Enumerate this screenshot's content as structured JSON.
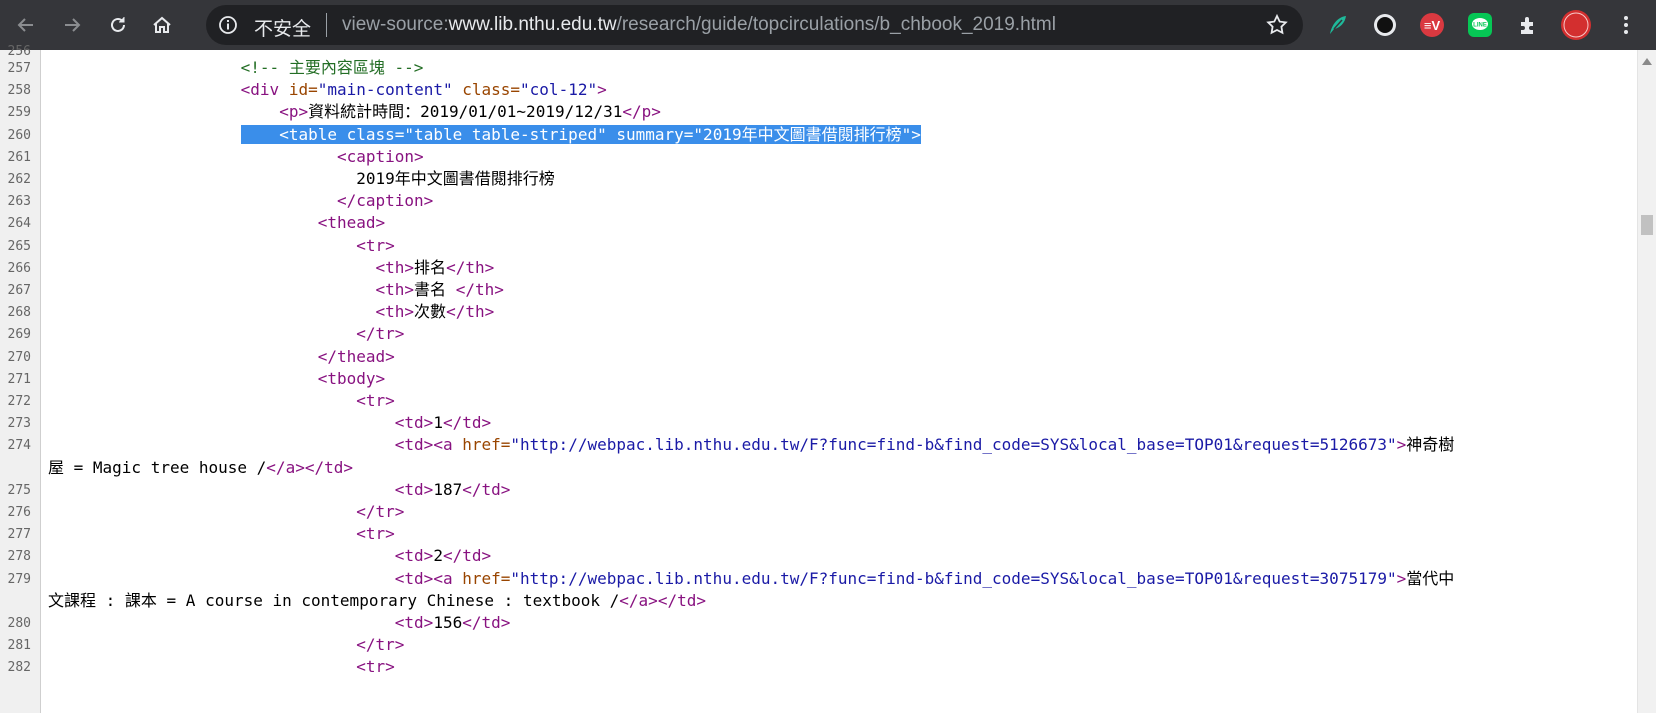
{
  "browser": {
    "security_label": "不安全",
    "url_prefix": "view-source:",
    "url_host": "www.lib.nthu.edu.tw",
    "url_path": "/research/guide/topcirculations/b_chbook_2019.html",
    "extensions": [
      "feather-extension-icon",
      "circle-extension-icon",
      "expressvpn-extension-icon",
      "line-extension-icon",
      "puzzle-extensions-icon",
      "profile-seal-avatar"
    ],
    "profile_seal_text": "貨品小屋"
  },
  "source": {
    "partial_top_line": "256",
    "lines": [
      {
        "num": "257",
        "segs": [
          {
            "t": "cmt",
            "v": "                    <!-- 主要內容區塊 -->"
          }
        ]
      },
      {
        "num": "258",
        "segs": [
          {
            "t": "txt",
            "v": "                    "
          },
          {
            "t": "tag",
            "v": "<div "
          },
          {
            "t": "attr",
            "v": "id="
          },
          {
            "t": "val",
            "v": "\"main-content\""
          },
          {
            "t": "attr",
            "v": " class="
          },
          {
            "t": "val",
            "v": "\"col-12\""
          },
          {
            "t": "tag",
            "v": ">"
          }
        ]
      },
      {
        "num": "259",
        "segs": [
          {
            "t": "txt",
            "v": "                        "
          },
          {
            "t": "tag",
            "v": "<p>"
          },
          {
            "t": "txt",
            "v": "資料統計時間：2019/01/01~2019/12/31"
          },
          {
            "t": "tag",
            "v": "</p>"
          }
        ]
      },
      {
        "num": "260",
        "selected": true,
        "indent": "                    ",
        "segs": [
          {
            "t": "tag",
            "v": "    <table "
          },
          {
            "t": "attr",
            "v": "class="
          },
          {
            "t": "val",
            "v": "\"table table-striped\""
          },
          {
            "t": "attr",
            "v": " summary="
          },
          {
            "t": "val",
            "v": "\"2019年中文圖書借閱排行榜\""
          },
          {
            "t": "tag",
            "v": ">"
          }
        ]
      },
      {
        "num": "261",
        "segs": [
          {
            "t": "txt",
            "v": "                              "
          },
          {
            "t": "tag",
            "v": "<caption>"
          }
        ]
      },
      {
        "num": "262",
        "segs": [
          {
            "t": "txt",
            "v": "                                2019年中文圖書借閱排行榜"
          }
        ]
      },
      {
        "num": "263",
        "segs": [
          {
            "t": "txt",
            "v": "                              "
          },
          {
            "t": "tag",
            "v": "</caption>"
          }
        ]
      },
      {
        "num": "264",
        "segs": [
          {
            "t": "txt",
            "v": "                            "
          },
          {
            "t": "tag",
            "v": "<thead>"
          }
        ]
      },
      {
        "num": "265",
        "segs": [
          {
            "t": "txt",
            "v": "                                "
          },
          {
            "t": "tag",
            "v": "<tr>"
          }
        ]
      },
      {
        "num": "266",
        "segs": [
          {
            "t": "txt",
            "v": "                                  "
          },
          {
            "t": "tag",
            "v": "<th>"
          },
          {
            "t": "txt",
            "v": "排名"
          },
          {
            "t": "tag",
            "v": "</th>"
          }
        ]
      },
      {
        "num": "267",
        "segs": [
          {
            "t": "txt",
            "v": "                                  "
          },
          {
            "t": "tag",
            "v": "<th>"
          },
          {
            "t": "txt",
            "v": "書名 "
          },
          {
            "t": "tag",
            "v": "</th>"
          }
        ]
      },
      {
        "num": "268",
        "segs": [
          {
            "t": "txt",
            "v": "                                  "
          },
          {
            "t": "tag",
            "v": "<th>"
          },
          {
            "t": "txt",
            "v": "次數"
          },
          {
            "t": "tag",
            "v": "</th>"
          }
        ]
      },
      {
        "num": "269",
        "segs": [
          {
            "t": "txt",
            "v": "                                "
          },
          {
            "t": "tag",
            "v": "</tr>"
          }
        ]
      },
      {
        "num": "270",
        "segs": [
          {
            "t": "txt",
            "v": "                            "
          },
          {
            "t": "tag",
            "v": "</thead>"
          }
        ]
      },
      {
        "num": "271",
        "segs": [
          {
            "t": "txt",
            "v": "                            "
          },
          {
            "t": "tag",
            "v": "<tbody>"
          }
        ]
      },
      {
        "num": "272",
        "segs": [
          {
            "t": "txt",
            "v": "                                "
          },
          {
            "t": "tag",
            "v": "<tr>"
          }
        ]
      },
      {
        "num": "273",
        "segs": [
          {
            "t": "txt",
            "v": "                                    "
          },
          {
            "t": "tag",
            "v": "<td>"
          },
          {
            "t": "txt",
            "v": "1"
          },
          {
            "t": "tag",
            "v": "</td>"
          }
        ]
      },
      {
        "num": "274",
        "segs": [
          {
            "t": "txt",
            "v": "                                    "
          },
          {
            "t": "tag",
            "v": "<td><a "
          },
          {
            "t": "attr",
            "v": "href="
          },
          {
            "t": "val",
            "v": "\"http://webpac.lib.nthu.edu.tw/F?func=find-b&find_code=SYS&local_base=TOP01&request=5126673\""
          },
          {
            "t": "tag",
            "v": ">"
          },
          {
            "t": "txt",
            "v": "神奇樹"
          }
        ]
      },
      {
        "num": "",
        "segs": [
          {
            "t": "txt",
            "v": "屋 = Magic tree house /"
          },
          {
            "t": "tag",
            "v": "</a></td>"
          }
        ]
      },
      {
        "num": "275",
        "segs": [
          {
            "t": "txt",
            "v": "                                    "
          },
          {
            "t": "tag",
            "v": "<td>"
          },
          {
            "t": "txt",
            "v": "187"
          },
          {
            "t": "tag",
            "v": "</td>"
          }
        ]
      },
      {
        "num": "276",
        "segs": [
          {
            "t": "txt",
            "v": "                                "
          },
          {
            "t": "tag",
            "v": "</tr>"
          }
        ]
      },
      {
        "num": "277",
        "segs": [
          {
            "t": "txt",
            "v": "                                "
          },
          {
            "t": "tag",
            "v": "<tr>"
          }
        ]
      },
      {
        "num": "278",
        "segs": [
          {
            "t": "txt",
            "v": "                                    "
          },
          {
            "t": "tag",
            "v": "<td>"
          },
          {
            "t": "txt",
            "v": "2"
          },
          {
            "t": "tag",
            "v": "</td>"
          }
        ]
      },
      {
        "num": "279",
        "segs": [
          {
            "t": "txt",
            "v": "                                    "
          },
          {
            "t": "tag",
            "v": "<td><a "
          },
          {
            "t": "attr",
            "v": "href="
          },
          {
            "t": "val",
            "v": "\"http://webpac.lib.nthu.edu.tw/F?func=find-b&find_code=SYS&local_base=TOP01&request=3075179\""
          },
          {
            "t": "tag",
            "v": ">"
          },
          {
            "t": "txt",
            "v": "當代中"
          }
        ]
      },
      {
        "num": "",
        "segs": [
          {
            "t": "txt",
            "v": "文課程 : 課本 = A course in contemporary Chinese : textbook /"
          },
          {
            "t": "tag",
            "v": "</a></td>"
          }
        ]
      },
      {
        "num": "280",
        "segs": [
          {
            "t": "txt",
            "v": "                                    "
          },
          {
            "t": "tag",
            "v": "<td>"
          },
          {
            "t": "txt",
            "v": "156"
          },
          {
            "t": "tag",
            "v": "</td>"
          }
        ]
      },
      {
        "num": "281",
        "segs": [
          {
            "t": "txt",
            "v": "                                "
          },
          {
            "t": "tag",
            "v": "</tr>"
          }
        ]
      },
      {
        "num": "282",
        "segs": [
          {
            "t": "txt",
            "v": "                                "
          },
          {
            "t": "tag",
            "v": "<tr>"
          }
        ]
      }
    ]
  }
}
